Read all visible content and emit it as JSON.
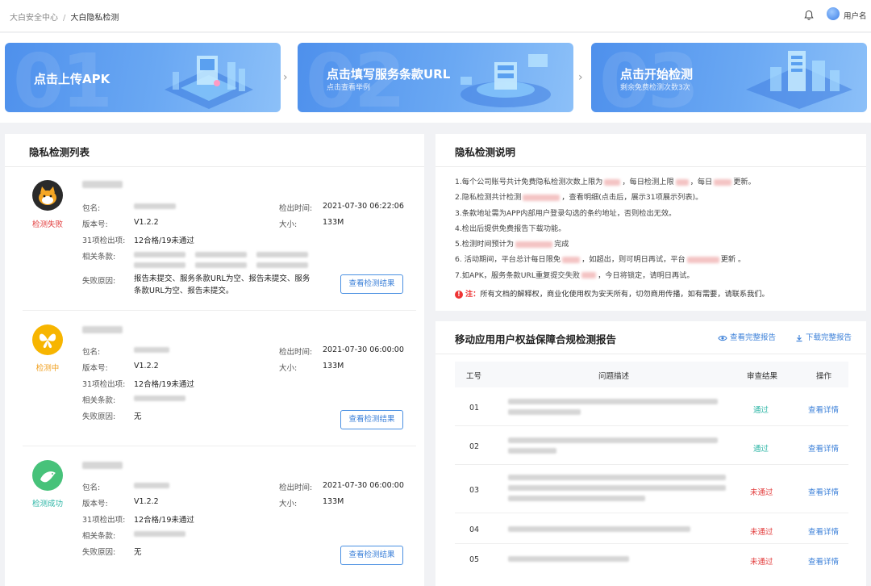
{
  "breadcrumb": {
    "root": "大白安全中心",
    "sep": "/",
    "current": "大白隐私检测"
  },
  "header": {
    "username": "用户名"
  },
  "steps": [
    {
      "title": "点击上传APK",
      "subtitle": "",
      "bignum": "01"
    },
    {
      "title": "点击填写服务条款URL",
      "subtitle": "点击查看举例",
      "bignum": "02"
    },
    {
      "title": "点击开始检测",
      "subtitle": "剩余免费检测次数3次",
      "bignum": "03"
    }
  ],
  "list": {
    "title": "隐私检测列表",
    "labels": {
      "package": "包名:",
      "version": "版本号:",
      "items": "31项检出项:",
      "clauses": "相关条款:",
      "reason": "失败原因:",
      "time": "检出时间:",
      "size": "大小:",
      "button": "查看检测结果"
    },
    "items": [
      {
        "status": "检测失败",
        "status_color": "#e23b3b",
        "icon_color": "#2a2a2a",
        "version": "V1.2.2",
        "items_result": "12合格/19未通过",
        "time": "2021-07-30  06:22:06",
        "size": "133M",
        "reason": "报告未提交、服务条款URL为空、报告未提交、服务条款URL为空、报告未提交。"
      },
      {
        "status": "检测中",
        "status_color": "#f0a020",
        "icon_color": "#f7b500",
        "version": "V1.2.2",
        "items_result": "12合格/19未通过",
        "time": "2021-07-30  06:00:00",
        "size": "133M",
        "reason": "无"
      },
      {
        "status": "检测成功",
        "status_color": "#2bb5a5",
        "icon_color": "#47c27a",
        "version": "V1.2.2",
        "items_result": "12合格/19未通过",
        "time": "2021-07-30  06:00:00",
        "size": "133M",
        "reason": "无"
      }
    ]
  },
  "notes": {
    "title": "隐私检测说明",
    "lines": [
      [
        "1.每个公司账号共计免费隐私检测次数上限为",
        "，每日检测上限",
        "，每日",
        "更新。"
      ],
      [
        "2.隐私检测共计检测",
        "，查看明细(点击后，展示31项展示列表)。"
      ],
      [
        "3.条款地址需为APP内部用户登录勾选的条约地址，否则检出无效。"
      ],
      [
        "4.检出后提供免费报告下载功能。"
      ],
      [
        "5.检测时间预计为",
        "完成"
      ],
      [
        "6. 活动期间，平台总计每日限免",
        "，如超出，则可明日再试，平台",
        "更新 。"
      ],
      [
        "7.如APK，服务条款URL重复提交失败",
        "，今日将锁定，请明日再试。"
      ]
    ],
    "warn_label": "注：",
    "warn_text": "所有文档的解释权，商业化使用权为安天所有，切勿商用传播，如有需要，请联系我们。"
  },
  "report": {
    "title": "移动应用用户权益保障合规检测报告",
    "view_full": "查看完整报告",
    "download_full": "下载完整报告",
    "columns": [
      "工号",
      "问题描述",
      "审查结果",
      "操作"
    ],
    "rows": [
      {
        "id": "01",
        "result": "通过",
        "pass": true,
        "action": "查看详情"
      },
      {
        "id": "02",
        "result": "通过",
        "pass": true,
        "action": "查看详情"
      },
      {
        "id": "03",
        "result": "未通过",
        "pass": false,
        "action": "查看详情"
      },
      {
        "id": "04",
        "result": "未通过",
        "pass": false,
        "action": "查看详情"
      },
      {
        "id": "05",
        "result": "未通过",
        "pass": false,
        "action": "查看详情"
      }
    ]
  },
  "icons": {
    "bell": "bell-icon",
    "avatar": "avatar",
    "chevron": "chevron-right-icon",
    "eye": "eye-icon",
    "download": "download-icon",
    "warning": "warning-icon"
  },
  "colors": {
    "accent": "#3a7fd8",
    "pass": "#2bb5a5",
    "fail": "#e23b3b",
    "pending": "#f0a020"
  }
}
